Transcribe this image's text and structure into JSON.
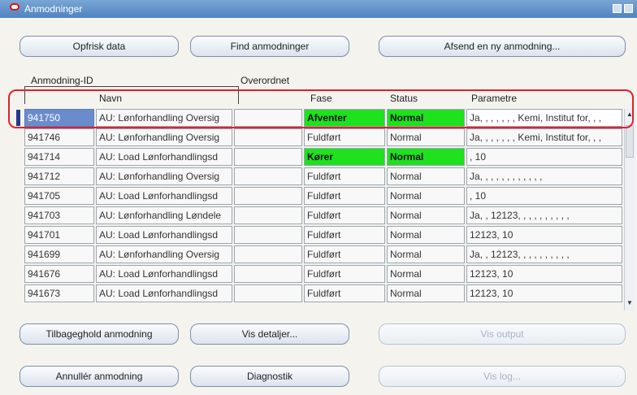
{
  "window": {
    "title": "Anmodninger"
  },
  "toolbar": {
    "refresh_label": "Opfrisk data",
    "find_label": "Find anmodninger",
    "submit_label": "Afsend en ny anmodning..."
  },
  "table": {
    "group_headers": {
      "id": "Anmodning-ID",
      "parent": "Overordnet"
    },
    "columns": {
      "name": "Navn",
      "phase": "Fase",
      "status": "Status",
      "params": "Parametre"
    },
    "rows": [
      {
        "id": "941750",
        "name": "AU: Lønforhandling Oversig",
        "parent": "",
        "phase": "Afventer",
        "status": "Normal",
        "params": "Ja, , , , , , , Kemi, Institut for, , ,"
      },
      {
        "id": "941746",
        "name": "AU: Lønforhandling Oversig",
        "parent": "",
        "phase": "Fuldført",
        "status": "Normal",
        "params": "Ja, , , , , , , Kemi, Institut for, , ,"
      },
      {
        "id": "941714",
        "name": "AU: Load Lønforhandlingsd",
        "parent": "",
        "phase": "Kører",
        "status": "Normal",
        "params": ", 10"
      },
      {
        "id": "941712",
        "name": "AU: Lønforhandling Oversig",
        "parent": "",
        "phase": "Fuldført",
        "status": "Normal",
        "params": "Ja, , , , , , , , , , , ,"
      },
      {
        "id": "941705",
        "name": "AU: Load Lønforhandlingsd",
        "parent": "",
        "phase": "Fuldført",
        "status": "Normal",
        "params": ", 10"
      },
      {
        "id": "941703",
        "name": "AU: Lønforhandling Løndele",
        "parent": "",
        "phase": "Fuldført",
        "status": "Normal",
        "params": "Ja, , 12123, , , , , , , , , ,"
      },
      {
        "id": "941701",
        "name": "AU: Load Lønforhandlingsd",
        "parent": "",
        "phase": "Fuldført",
        "status": "Normal",
        "params": "12123, 10"
      },
      {
        "id": "941699",
        "name": "AU: Lønforhandling Oversig",
        "parent": "",
        "phase": "Fuldført",
        "status": "Normal",
        "params": "Ja, , 12123, , , , , , , , , ,"
      },
      {
        "id": "941676",
        "name": "AU: Load Lønforhandlingsd",
        "parent": "",
        "phase": "Fuldført",
        "status": "Normal",
        "params": "12123, 10"
      },
      {
        "id": "941673",
        "name": "AU: Load Lønforhandlingsd",
        "parent": "",
        "phase": "Fuldført",
        "status": "Normal",
        "params": "12123, 10"
      }
    ]
  },
  "actions": {
    "hold_label": "Tilbageghold anmodning",
    "details_label": "Vis detaljer...",
    "output_label": "Vis output",
    "cancel_label": "Annullér anmodning",
    "diagnostics_label": "Diagnostik",
    "log_label": "Vis log..."
  },
  "colors": {
    "highlight": "#1de21d",
    "annotation": "#e0202a",
    "titlebar": "#4f82c0"
  }
}
